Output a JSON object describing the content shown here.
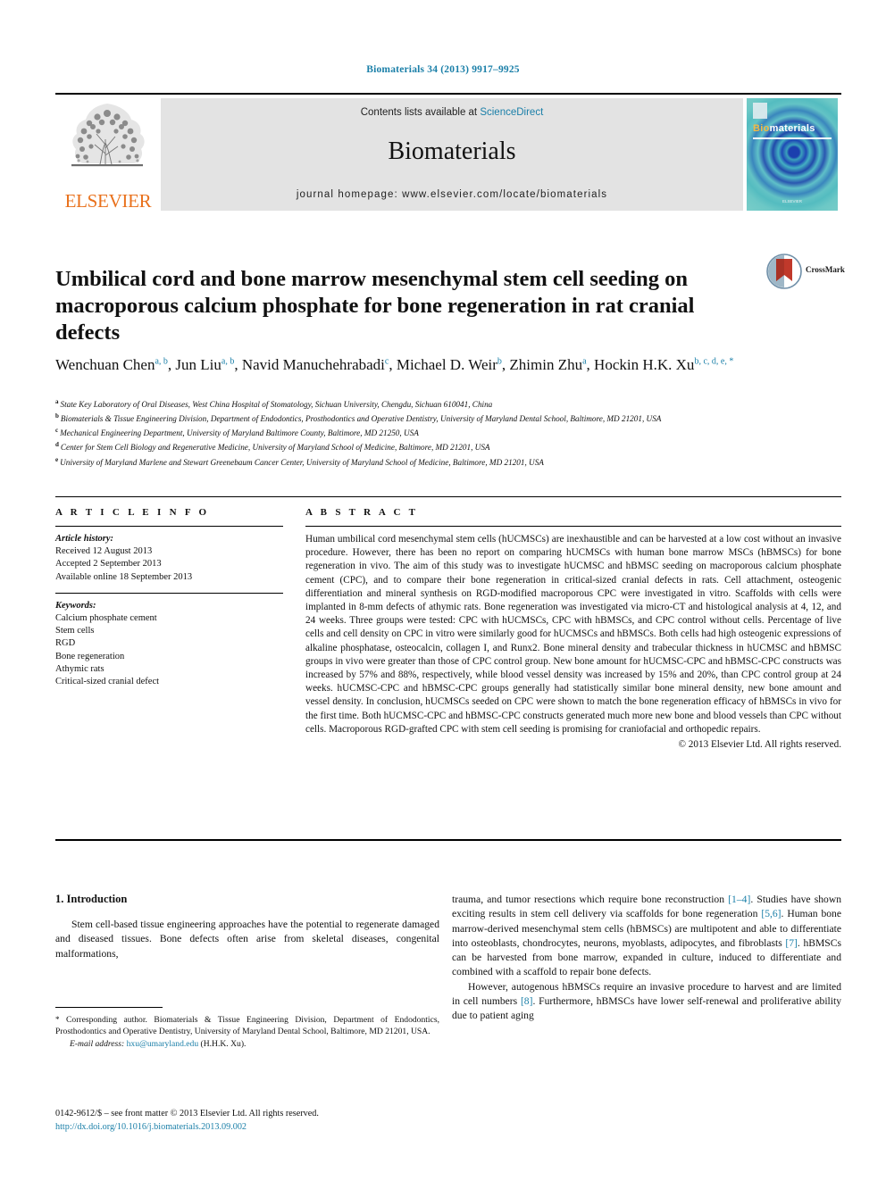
{
  "running_head": "Biomaterials 34 (2013) 9917–9925",
  "masthead": {
    "contents_prefix": "Contents lists available at ",
    "sciencedirect": "ScienceDirect",
    "journal_name": "Biomaterials",
    "homepage": "journal homepage: www.elsevier.com/locate/biomaterials",
    "publisher_wordmark": "ELSEVIER",
    "cover": {
      "title_part1": "Bio",
      "title_part2": "materials",
      "footer": "ELSEVIER"
    }
  },
  "article": {
    "title": "Umbilical cord and bone marrow mesenchymal stem cell seeding on macroporous calcium phosphate for bone regeneration in rat cranial defects",
    "crossmark_label": "CrossMark",
    "authors": [
      {
        "name": "Wenchuan Chen",
        "marks": "a, b",
        "sep": ","
      },
      {
        "name": "Jun Liu",
        "marks": "a, b",
        "sep": ","
      },
      {
        "name": "Navid Manuchehrabadi",
        "marks": "c",
        "sep": ","
      },
      {
        "name": "Michael D. Weir",
        "marks": "b",
        "sep": ","
      },
      {
        "name": "Zhimin Zhu",
        "marks": "a",
        "sep": ","
      },
      {
        "name": "Hockin H.K. Xu",
        "marks": "b, c, d, e, *",
        "sep": ""
      }
    ],
    "affiliations": [
      {
        "label": "a",
        "text": "State Key Laboratory of Oral Diseases, West China Hospital of Stomatology, Sichuan University, Chengdu, Sichuan 610041, China"
      },
      {
        "label": "b",
        "text": "Biomaterials & Tissue Engineering Division, Department of Endodontics, Prosthodontics and Operative Dentistry, University of Maryland Dental School, Baltimore, MD 21201, USA"
      },
      {
        "label": "c",
        "text": "Mechanical Engineering Department, University of Maryland Baltimore County, Baltimore, MD 21250, USA"
      },
      {
        "label": "d",
        "text": "Center for Stem Cell Biology and Regenerative Medicine, University of Maryland School of Medicine, Baltimore, MD 21201, USA"
      },
      {
        "label": "e",
        "text": "University of Maryland Marlene and Stewart Greenebaum Cancer Center, University of Maryland School of Medicine, Baltimore, MD 21201, USA"
      }
    ]
  },
  "article_info": {
    "heading": "A R T I C L E   I N F O",
    "history_label": "Article history:",
    "history": [
      "Received 12 August 2013",
      "Accepted 2 September 2013",
      "Available online 18 September 2013"
    ],
    "keywords_label": "Keywords:",
    "keywords": [
      "Calcium phosphate cement",
      "Stem cells",
      "RGD",
      "Bone regeneration",
      "Athymic rats",
      "Critical-sized cranial defect"
    ]
  },
  "abstract": {
    "heading": "A B S T R A C T",
    "body": "Human umbilical cord mesenchymal stem cells (hUCMSCs) are inexhaustible and can be harvested at a low cost without an invasive procedure. However, there has been no report on comparing hUCMSCs with human bone marrow MSCs (hBMSCs) for bone regeneration in vivo. The aim of this study was to investigate hUCMSC and hBMSC seeding on macroporous calcium phosphate cement (CPC), and to compare their bone regeneration in critical-sized cranial defects in rats. Cell attachment, osteogenic differentiation and mineral synthesis on RGD-modified macroporous CPC were investigated in vitro. Scaffolds with cells were implanted in 8-mm defects of athymic rats. Bone regeneration was investigated via micro-CT and histological analysis at 4, 12, and 24 weeks. Three groups were tested: CPC with hUCMSCs, CPC with hBMSCs, and CPC control without cells. Percentage of live cells and cell density on CPC in vitro were similarly good for hUCMSCs and hBMSCs. Both cells had high osteogenic expressions of alkaline phosphatase, osteocalcin, collagen I, and Runx2. Bone mineral density and trabecular thickness in hUCMSC and hBMSC groups in vivo were greater than those of CPC control group. New bone amount for hUCMSC-CPC and hBMSC-CPC constructs was increased by 57% and 88%, respectively, while blood vessel density was increased by 15% and 20%, than CPC control group at 24 weeks. hUCMSC-CPC and hBMSC-CPC groups generally had statistically similar bone mineral density, new bone amount and vessel density. In conclusion, hUCMSCs seeded on CPC were shown to match the bone regeneration efficacy of hBMSCs in vivo for the first time. Both hUCMSC-CPC and hBMSC-CPC constructs generated much more new bone and blood vessels than CPC without cells. Macroporous RGD-grafted CPC with stem cell seeding is promising for craniofacial and orthopedic repairs.",
    "copyright": "© 2013 Elsevier Ltd. All rights reserved."
  },
  "introduction": {
    "heading": "1.  Introduction",
    "left_paragraph": "Stem cell-based tissue engineering approaches have the potential to regenerate damaged and diseased tissues. Bone defects often arise from skeletal diseases, congenital malformations,",
    "right_paragraph_1_a": "trauma, and tumor resections which require bone reconstruction ",
    "right_ref_1": "[1–4]",
    "right_paragraph_1_b": ". Studies have shown exciting results in stem cell delivery via scaffolds for bone regeneration ",
    "right_ref_2": "[5,6]",
    "right_paragraph_1_c": ". Human bone marrow-derived mesenchymal stem cells (hBMSCs) are multipotent and able to differentiate into osteoblasts, chondrocytes, neurons, myoblasts, adipocytes, and fibroblasts ",
    "right_ref_3": "[7]",
    "right_paragraph_1_d": ". hBMSCs can be harvested from bone marrow, expanded in culture, induced to differentiate and combined with a scaffold to repair bone defects.",
    "right_paragraph_2_a": "However, autogenous hBMSCs require an invasive procedure to harvest and are limited in cell numbers ",
    "right_ref_4": "[8]",
    "right_paragraph_2_b": ". Furthermore, hBMSCs have lower self-renewal and proliferative ability due to patient aging"
  },
  "footnotes": {
    "corresponding_star": "*",
    "corresponding_text": " Corresponding author. Biomaterials & Tissue Engineering Division, Department of Endodontics, Prosthodontics and Operative Dentistry, University of Maryland Dental School, Baltimore, MD 21201, USA.",
    "email_label": "E-mail address:",
    "email": "hxu@umaryland.edu",
    "email_suffix": " (H.H.K. Xu)."
  },
  "imprint": {
    "line1": "0142-9612/$ – see front matter © 2013 Elsevier Ltd. All rights reserved.",
    "doi": "http://dx.doi.org/10.1016/j.biomaterials.2013.09.002"
  },
  "colors": {
    "link": "#1a7fa8",
    "elsevier_orange": "#E9711C",
    "masthead_gray": "#e3e3e3"
  }
}
